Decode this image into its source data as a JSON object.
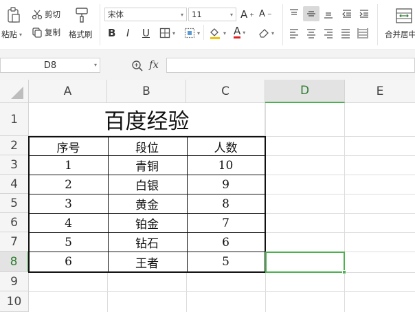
{
  "ribbon": {
    "paste": "粘贴",
    "cut": "剪切",
    "copy": "复制",
    "format_painter": "格式刷",
    "font_name": "宋体",
    "font_size": "11",
    "bold": "B",
    "italic": "I",
    "underline": "U",
    "font_color_letter": "A",
    "grow_font": "A",
    "shrink_font": "A",
    "merge_center": "合并居中"
  },
  "formula_bar": {
    "name_box": "D8",
    "fx": "fx",
    "formula": ""
  },
  "columns": [
    "A",
    "B",
    "C",
    "D",
    "E"
  ],
  "rows": [
    "1",
    "2",
    "3",
    "4",
    "5",
    "6",
    "7",
    "8",
    "9",
    "10"
  ],
  "table": {
    "title": "百度经验",
    "headers": [
      "序号",
      "段位",
      "人数"
    ],
    "rows": [
      [
        "1",
        "青铜",
        "10"
      ],
      [
        "2",
        "白银",
        "9"
      ],
      [
        "3",
        "黄金",
        "8"
      ],
      [
        "4",
        "铂金",
        "7"
      ],
      [
        "5",
        "钻石",
        "6"
      ],
      [
        "6",
        "王者",
        "5"
      ]
    ]
  },
  "selected_cell": "D8",
  "colors": {
    "selection": "#4caf50",
    "header_bg": "#f5f5f5"
  }
}
